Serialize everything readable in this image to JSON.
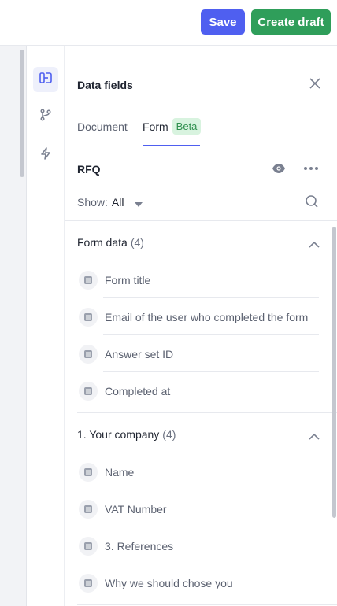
{
  "toolbar": {
    "save_label": "Save",
    "create_draft_label": "Create draft"
  },
  "rail": {
    "items": [
      {
        "icon": "data-fields-icon",
        "active": true
      },
      {
        "icon": "branch-icon",
        "active": false
      },
      {
        "icon": "lightning-icon",
        "active": false
      }
    ]
  },
  "panel": {
    "title": "Data fields",
    "tabs": [
      {
        "label": "Document",
        "active": false
      },
      {
        "label": "Form",
        "badge": "Beta",
        "active": true
      }
    ],
    "source_name": "RFQ",
    "show_label": "Show:",
    "show_value": "All"
  },
  "groups": [
    {
      "title": "Form data",
      "count": "(4)",
      "expanded": true,
      "fields": [
        "Form title",
        "Email of the user who completed the form",
        "Answer set ID",
        "Completed at"
      ]
    },
    {
      "title": "1. Your company",
      "count": "(4)",
      "expanded": true,
      "fields": [
        "Name",
        "VAT Number",
        "3. References",
        "Why we should chose you"
      ]
    }
  ],
  "colors": {
    "primary": "#4f5ff0",
    "success": "#2f9e5a",
    "beta_bg": "#d8f3df",
    "beta_text": "#2f8f4e"
  }
}
